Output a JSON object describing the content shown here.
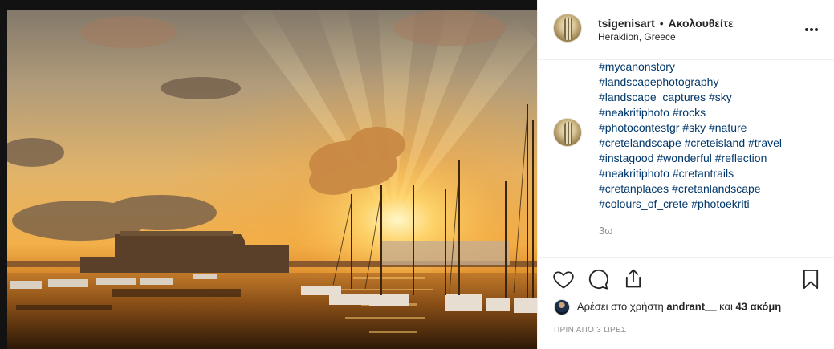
{
  "post": {
    "username": "tsigenisart",
    "separator": "•",
    "follow_status": "Ακολουθείτε",
    "location": "Heraklion, Greece",
    "more_icon": "more-options-icon"
  },
  "caption": {
    "hashtag_lines": [
      "#mycanonstory",
      "#landscapephotography",
      "#landscape_captures #sky",
      "#neakritiphoto #rocks",
      "#photocontestgr #sky #nature",
      "#cretelandscape #creteisland #travel",
      "#instagood #wonderful #reflection",
      "#neakritiphoto #cretantrails",
      "#cretanplaces #cretanlandscape",
      "#colours_of_crete #photoekriti"
    ],
    "time_ago": "3ω"
  },
  "actions": {
    "like_icon": "heart-icon",
    "comment_icon": "comment-icon",
    "share_icon": "share-icon",
    "save_icon": "bookmark-icon"
  },
  "likes": {
    "prefix": "Αρέσει στο χρήστη",
    "user": "andrant__",
    "middle": "και",
    "count_text": "43 ακόμη"
  },
  "posted_time": "ΠΡΙΝ ΑΠΟ 3 ΩΡΕΣ",
  "colors": {
    "hashtag": "#00376b",
    "muted": "#8e8e8e",
    "text": "#262626",
    "border": "#efefef"
  }
}
